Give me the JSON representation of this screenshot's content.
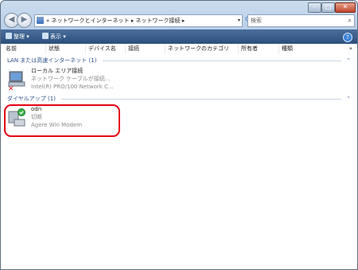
{
  "window": {
    "minimize": "–",
    "maximize": "□",
    "close": "✕"
  },
  "nav": {
    "back": "◀",
    "forward": "▶"
  },
  "address": {
    "crumbs": "« ネットワークとインターネット ▸ ネットワーク接続 ▸",
    "dropdown": "▾"
  },
  "search": {
    "placeholder": "検索",
    "icon": "search-icon"
  },
  "toolbar": {
    "organize": "整理 ▾",
    "view": "表示 ▾",
    "help": "?"
  },
  "columns": [
    "名前",
    "状態",
    "デバイス名",
    "接続",
    "ネットワークのカテゴリ",
    "所有者",
    "種類"
  ],
  "more_columns": "»",
  "groups": [
    {
      "title": "LAN または高速インターネット (1)"
    },
    {
      "title": "ダイヤルアップ (1)"
    }
  ],
  "items": [
    {
      "name": "ローカル エリア接続",
      "status": "ネットワーク ケーブルが接続...",
      "device": "Intel(R) PRO/100 Network C...",
      "icon": "network-disconnected-icon"
    },
    {
      "name": "odn",
      "status": "切断",
      "device": "Agere Win Modem",
      "icon": "dialup-connection-icon"
    }
  ],
  "colors": {
    "highlight": "#e60012",
    "toolbar": "#2c4f7c"
  }
}
